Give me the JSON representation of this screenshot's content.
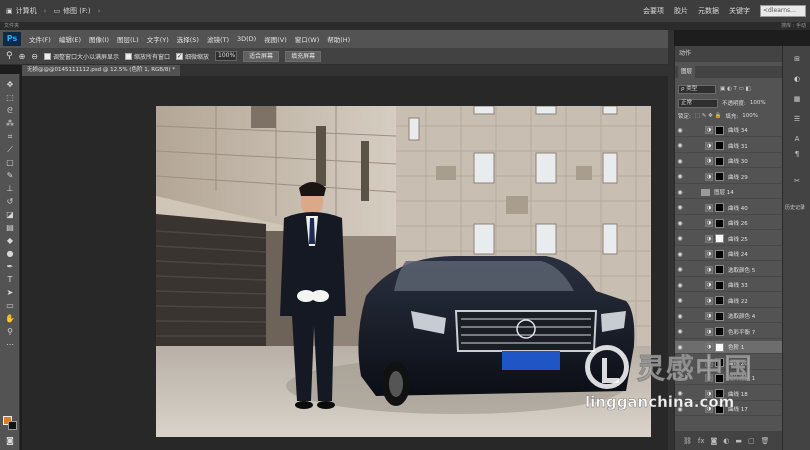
{
  "os": {
    "crumb1": "计算机",
    "crumb2": "修图 (F:)",
    "right_items": [
      "会要项",
      "胶片",
      "元数据",
      "关键字"
    ],
    "search_placeholder": "<dlearns...",
    "right_sub": "搜库 : 手动",
    "left_sub": "文件夹"
  },
  "menu": {
    "logo": "Ps",
    "items": [
      "文件(F)",
      "编辑(E)",
      "图像(I)",
      "图层(L)",
      "文字(Y)",
      "选择(S)",
      "滤镜(T)",
      "3D(D)",
      "视图(V)",
      "窗口(W)",
      "帮助(H)"
    ]
  },
  "options": {
    "check1": "调整窗口大小以满屏显示",
    "check2": "缩放所有窗口",
    "check3": "细微缩放",
    "zoom": "100%",
    "btn1": "适合屏幕",
    "btn2": "填充屏幕"
  },
  "document": {
    "tab": "无损@@@0145111112.psd @ 12.5% (色阶 1, RGB/8) *"
  },
  "panels": {
    "header": "动作",
    "layers_tab": "图层",
    "kind_label": "ρ 类型",
    "blend_mode": "正常",
    "opacity_label": "不透明度:",
    "opacity": "100%",
    "lock_label": "锁定:",
    "fill_label": "填充:",
    "fill": "100%",
    "layers": [
      {
        "name": "曲线 34",
        "mask": "black",
        "sel": false
      },
      {
        "name": "曲线 31",
        "mask": "black",
        "sel": false
      },
      {
        "name": "曲线 30",
        "mask": "black",
        "sel": false
      },
      {
        "name": "曲线 29",
        "mask": "black",
        "sel": false
      },
      {
        "name": "图层 14",
        "group": true,
        "sel": false
      },
      {
        "name": "曲线 40",
        "mask": "black",
        "sel": false
      },
      {
        "name": "曲线 26",
        "mask": "black",
        "sel": false
      },
      {
        "name": "曲线 25",
        "mask": "white",
        "sel": false
      },
      {
        "name": "曲线 24",
        "mask": "black",
        "sel": false
      },
      {
        "name": "选取颜色 5",
        "mask": "black",
        "sel": false
      },
      {
        "name": "曲线 33",
        "mask": "black",
        "sel": false
      },
      {
        "name": "曲线 22",
        "mask": "black",
        "sel": false
      },
      {
        "name": "选取颜色 4",
        "mask": "black",
        "sel": false
      },
      {
        "name": "色彩平衡 7",
        "mask": "black",
        "sel": false
      },
      {
        "name": "色阶 1",
        "mask": "white",
        "sel": true
      },
      {
        "name": "曲线 20",
        "mask": "black",
        "sel": false
      },
      {
        "name": "照片滤镜 1",
        "mask": "black",
        "sel": false
      },
      {
        "name": "曲线 18",
        "mask": "black",
        "sel": false
      },
      {
        "name": "曲线 17",
        "mask": "black",
        "sel": false
      }
    ],
    "mini_label": "历史记录"
  },
  "watermark": {
    "cn": "灵感中国",
    "en": "lingganchina.com"
  },
  "colors": {
    "foreground": "#e07b1f",
    "background": "#111111"
  }
}
